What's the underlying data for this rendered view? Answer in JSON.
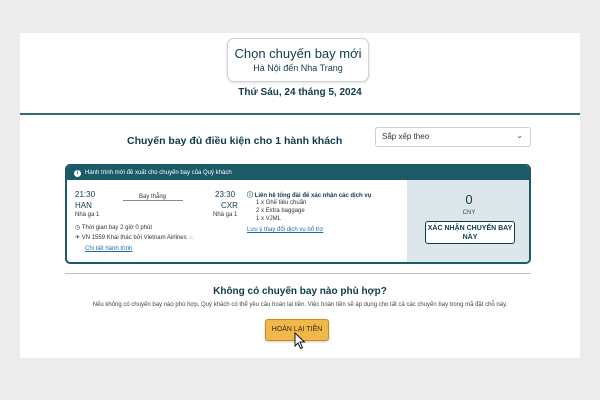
{
  "header": {
    "title": "Chọn chuyến bay mới",
    "subtitle": "Hà Nội đến Nha Trang",
    "date": "Thứ Sáu, 24 tháng 5, 2024"
  },
  "results": {
    "heading": "Chuyến bay đủ điều kiện cho 1 hành khách",
    "sort_value": "Sắp xếp theo"
  },
  "flight": {
    "banner": "Hành trình mới đề xuất cho chuyến bay của Quý khách",
    "depart_time": "21:30",
    "arrive_time": "23:30",
    "stops": "Bay thẳng",
    "origin": "HAN",
    "destination": "CXR",
    "origin_terminal": "Nhà ga 1",
    "destination_terminal": "Nhà ga 1",
    "duration": "Thời gian bay 2 giờ 0 phút",
    "operator": "VN 1559 Khai thác bởi Vietnam Airlines",
    "details_link": "Chi tiết hành trình",
    "services_heading": "Liên hệ tổng đài để xác nhận các dịch vụ",
    "services": [
      "1 x Ghế tiêu chuẩn",
      "2 x Extra baggage",
      "1 x VJML"
    ],
    "services_link": "Lưu ý thay đổi dịch vụ bổ trợ",
    "price": "0",
    "currency": "CNY",
    "confirm_label": "XÁC NHẬN CHUYẾN BAY NÀY"
  },
  "no_fit": {
    "heading": "Không có chuyến bay nào phù hợp?",
    "description": "Nếu không có chuyến bay nào phù hợp, Quý khách có thể yêu cầu hoàn lại tiền. Việc hoàn tiền sẽ áp dụng cho tất cả các chuyến bay trong mã đặt chỗ này.",
    "refund_label": "HOÀN LẠI TIỀN"
  },
  "colors": {
    "teal": "#1c5a68",
    "navy": "#0f3b4a",
    "refund_button": "#f0b84a",
    "price_panel": "#dde6ea"
  }
}
